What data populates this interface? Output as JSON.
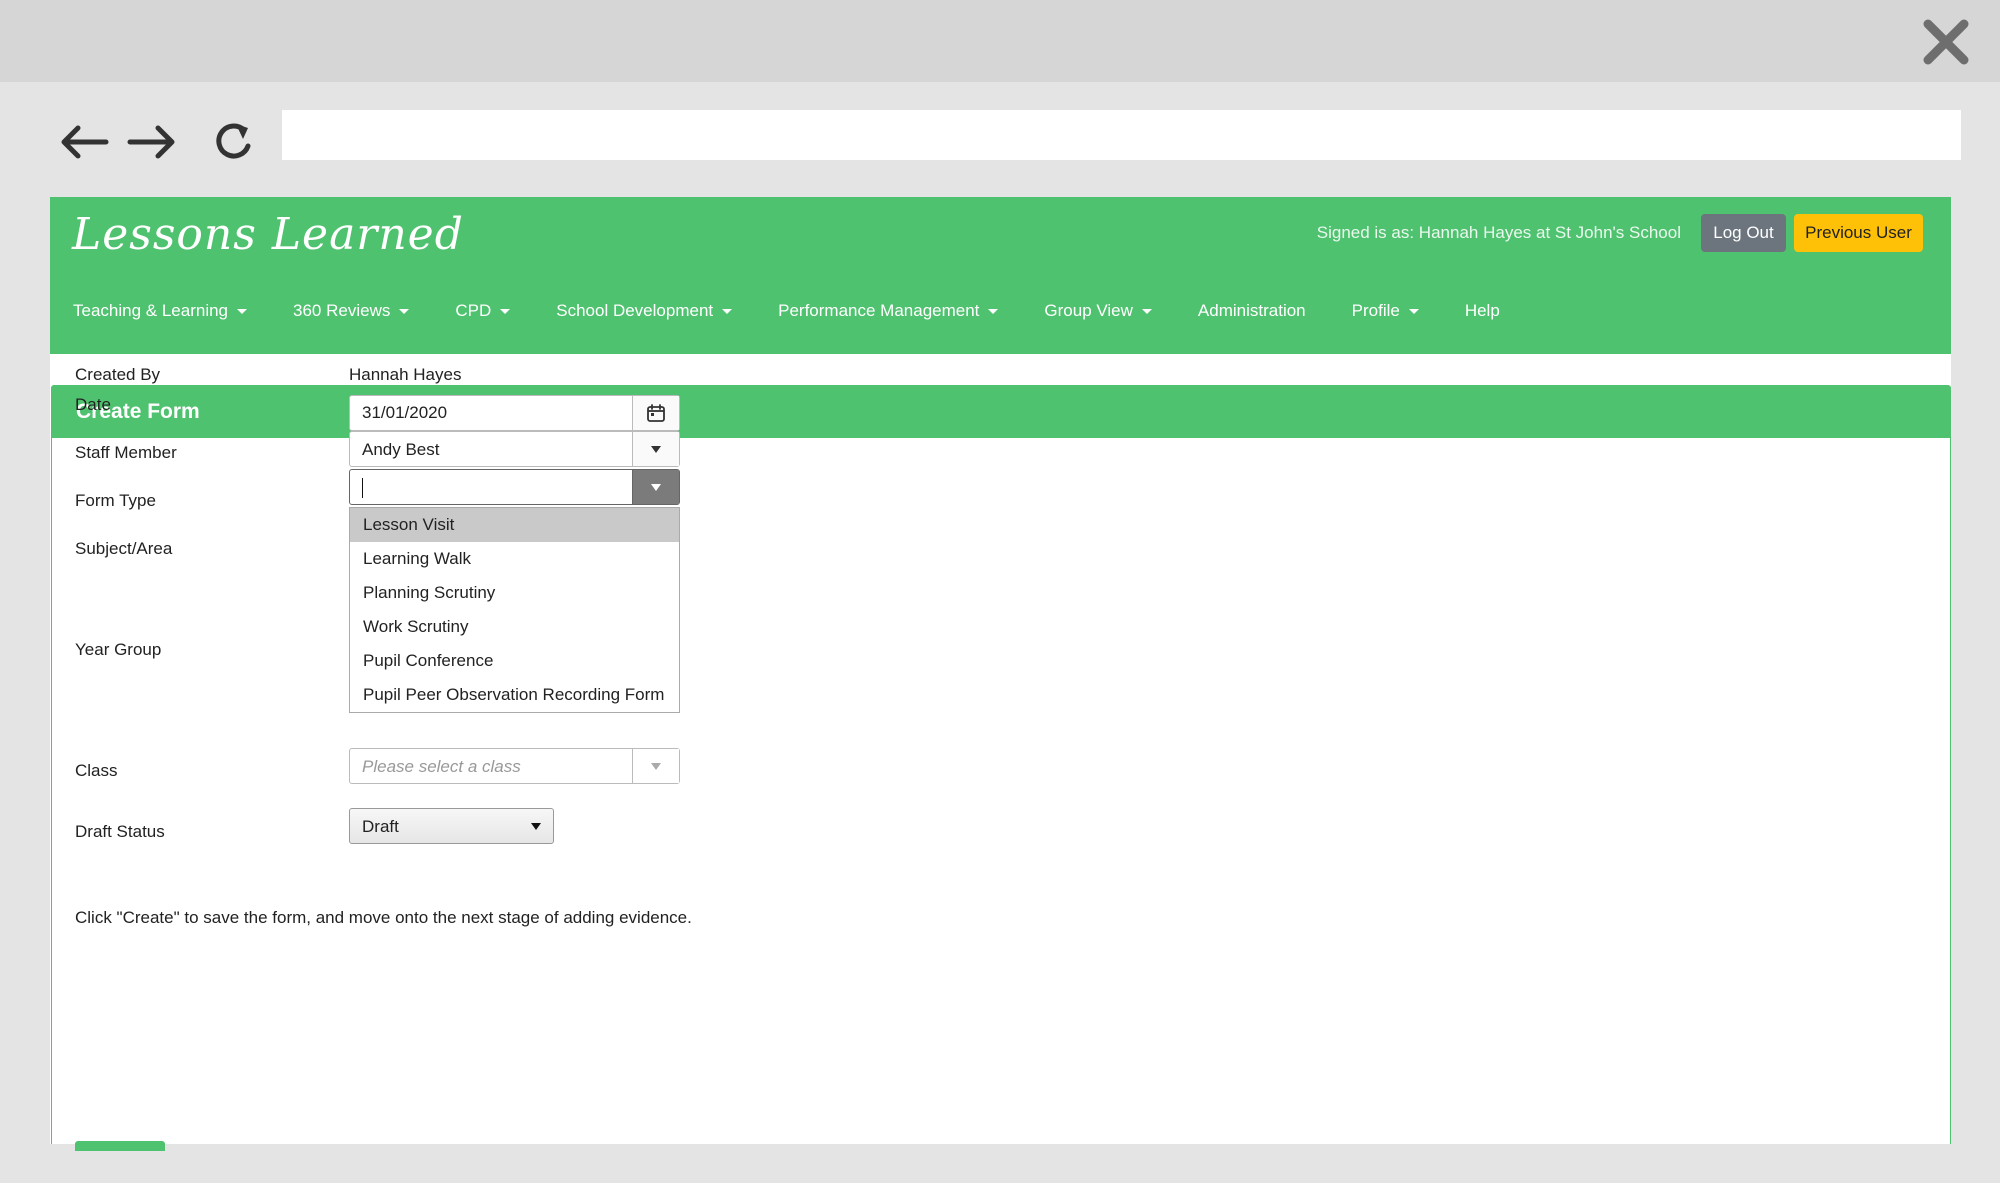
{
  "browser": {
    "address_value": "",
    "icons": {
      "back": "arrow-left-icon",
      "forward": "arrow-right-icon",
      "reload": "reload-icon",
      "close": "close-icon"
    }
  },
  "header": {
    "logo": "Lessons Learned",
    "signed_in_text": "Signed is as: Hannah Hayes at St John's School",
    "logout_label": "Log Out",
    "previous_user_label": "Previous User"
  },
  "nav": {
    "items": [
      {
        "label": "Teaching & Learning",
        "dropdown": true
      },
      {
        "label": "360 Reviews",
        "dropdown": true
      },
      {
        "label": "CPD",
        "dropdown": true
      },
      {
        "label": "School Development",
        "dropdown": true
      },
      {
        "label": "Performance Management",
        "dropdown": true
      },
      {
        "label": "Group View",
        "dropdown": true
      },
      {
        "label": "Administration",
        "dropdown": false
      },
      {
        "label": "Profile",
        "dropdown": true
      },
      {
        "label": "Help",
        "dropdown": false
      }
    ]
  },
  "form": {
    "title": "Create Form",
    "created_by_label": "Created By",
    "created_by_value": "Hannah Hayes",
    "date_label": "Date",
    "date_value": "31/01/2020",
    "staff_label": "Staff Member",
    "staff_value": "Andy Best",
    "form_type_label": "Form Type",
    "form_type_value": "",
    "form_type_options": [
      "Lesson Visit",
      "Learning Walk",
      "Planning Scrutiny",
      "Work Scrutiny",
      "Pupil Conference",
      "Pupil Peer Observation Recording Form"
    ],
    "form_type_highlighted": "Lesson Visit",
    "subject_label": "Subject/Area",
    "year_group_label": "Year Group",
    "class_label": "Class",
    "class_placeholder": "Please select a class",
    "draft_label": "Draft Status",
    "draft_value": "Draft",
    "hint": "Click \"Create\" to save the form, and move onto the next stage of adding evidence."
  },
  "colors": {
    "brand_green": "#4fc26f",
    "logout_grey": "#6c757d",
    "previous_user_yellow": "#ffc107"
  }
}
